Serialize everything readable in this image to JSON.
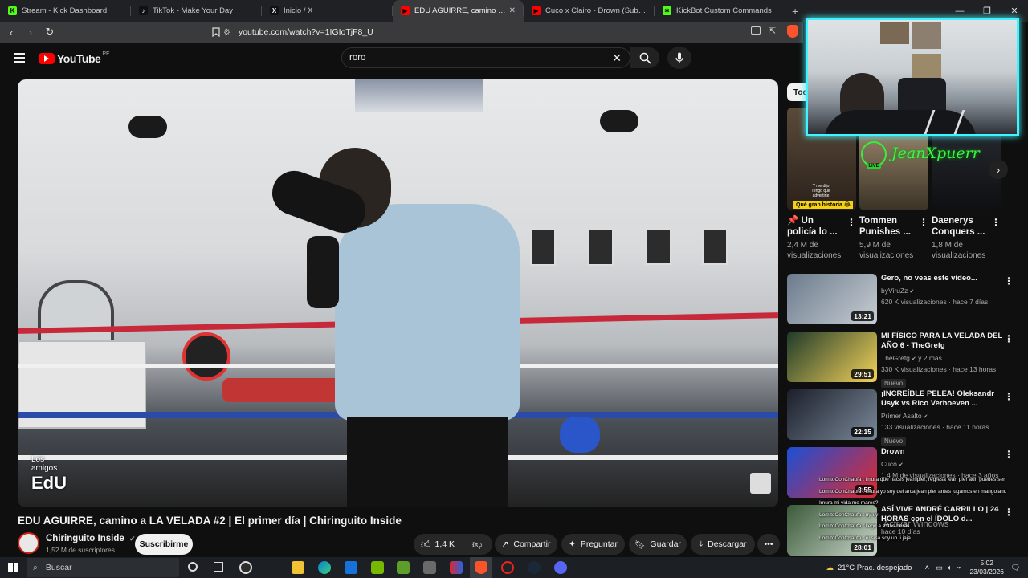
{
  "browser": {
    "tabs": [
      {
        "title": "Stream - Kick Dashboard",
        "fav_color": "#53fc18",
        "fav_glyph": "K"
      },
      {
        "title": "TikTok - Make Your Day",
        "fav_color": "#111111",
        "fav_glyph": "♪"
      },
      {
        "title": "Inicio / X",
        "fav_color": "#111111",
        "fav_glyph": "X"
      },
      {
        "title": "EDU AGUIRRE, camino a LA VELADA",
        "fav_color": "#ff0000",
        "fav_glyph": "▶",
        "active": true
      },
      {
        "title": "Cuco x Clairo - Drown (Sub. Español)",
        "fav_color": "#ff0000",
        "fav_glyph": "▶"
      },
      {
        "title": "KickBot Custom Commands",
        "fav_color": "#53fc18",
        "fav_glyph": "✱"
      }
    ],
    "new_tab": "+",
    "url": "youtube.com/watch?v=1IGIoTjF8_U"
  },
  "youtube": {
    "logo_text": "YouTube",
    "region": "PE",
    "search_value": "roro",
    "video_title": "EDU AGUIRRE, camino a LA VELADA #2 | El primer día | Chiringuito Inside",
    "channel": {
      "name": "Chiringuito Inside",
      "subscribers": "1,52 M de suscriptores",
      "subscribe_label": "Suscribirme"
    },
    "actions": {
      "likes": "1,4 K",
      "share": "Compartir",
      "ask": "Preguntar",
      "save": "Guardar",
      "download": "Descargar"
    },
    "watermark": {
      "line1": "Los",
      "line2": "amigos",
      "line3": "EdU"
    },
    "filter_chip": "Tod",
    "shorts": [
      {
        "title": "📌 Un policía lo ...",
        "views": "2,4 M de visualizaciones",
        "overlay_top": "Y me dijo",
        "overlay_bottom": "Tengo que advertirte",
        "tag": "Qué gran historia 😂"
      },
      {
        "title": "Tommen Punishes ...",
        "views": "5,9 M de visualizaciones"
      },
      {
        "title": "Daenerys Conquers ...",
        "views": "1,8 M de visualizaciones"
      }
    ],
    "recommendations": [
      {
        "title": "Gero, no veas este video...",
        "channel": "byViruZz",
        "meta": "620 K visualizaciones · hace 7 días",
        "duration": "13:21",
        "color1": "#6b7b8c",
        "color2": "#c7cdd3"
      },
      {
        "title": "MI FÍSICO PARA LA VELADA DEL AÑO 6 - TheGrefg",
        "channel": "TheGrefg",
        "channel_extra": "y 2 más",
        "meta": "330 K visualizaciones · hace 13 horas",
        "badge": "Nuevo",
        "duration": "29:51",
        "color1": "#1f3a2a",
        "color2": "#f3d25a"
      },
      {
        "title": "¡INCREÍBLE PELEA! Oleksandr Usyk vs Rico Verhoeven ...",
        "channel": "Primer Asalto",
        "meta": "133 visualizaciones · hace 11 horas",
        "badge": "Nuevo",
        "duration": "22:15",
        "color1": "#1b1f2a",
        "color2": "#7a8899"
      },
      {
        "title": "Drown",
        "channel": "Cuco",
        "meta": "1,4 M de visualizaciones · hace 3 años",
        "duration": "3:55",
        "color1": "#1b4fd6",
        "color2": "#e0292c"
      },
      {
        "title": "ASÍ VIVE ANDRÉ CARRILLO | 24 HORAS con el ÍDOLO d...",
        "channel": "",
        "meta": "hace 10 días",
        "duration": "28:01",
        "color1": "#3a5a3a",
        "color2": "#c9d6c9"
      }
    ]
  },
  "stream_overlay": {
    "streamer_name": "JeanXpuerr",
    "live_badge": "LIVE",
    "chat": [
      "LomitoConChaufa : imura que haces jeampier, regresa jean pier aun puedes ser",
      "LomitoConChaufa : imura yo soy del arca jean pier antes jugamos en mangoland",
      "Imura mi vida me mares?",
      "LomitoConChaufa : uy uy",
      "LomitoConChaufa : llego a estas horas",
      "LomitoConChaufa : el sisa soy uo ji jaja"
    ],
    "windows_watermark": "Activar Windows"
  },
  "taskbar": {
    "search_placeholder": "Buscar",
    "weather": "21°C  Prac. despejado",
    "time": "5:02",
    "date": "23/03/2026"
  }
}
